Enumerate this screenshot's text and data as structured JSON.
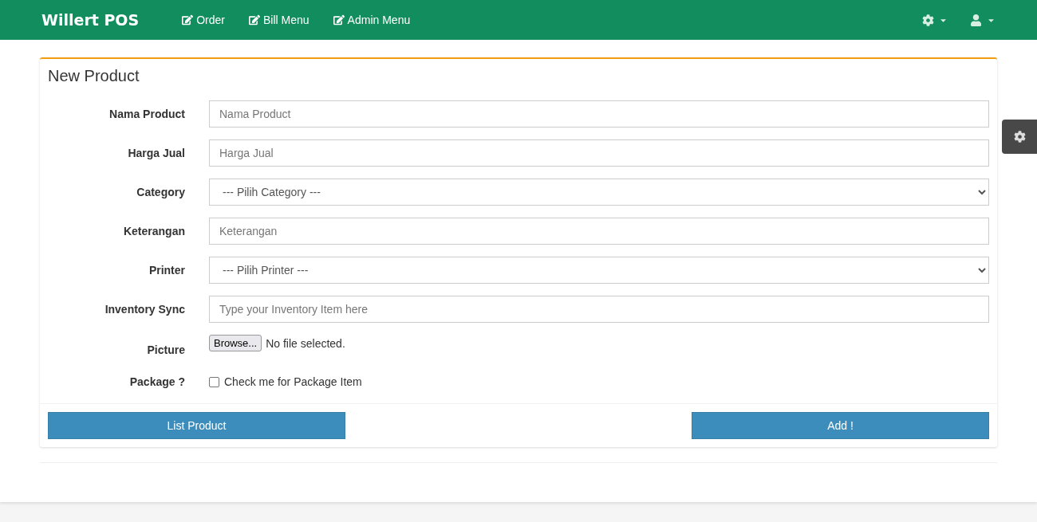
{
  "navbar": {
    "brand": "Willert POS",
    "links": [
      {
        "label": "Order"
      },
      {
        "label": "Bill Menu"
      },
      {
        "label": "Admin Menu"
      }
    ]
  },
  "panel": {
    "title": "New Product",
    "fields": [
      {
        "kind": "text",
        "label": "Nama Product",
        "placeholder": "Nama Product"
      },
      {
        "kind": "text",
        "label": "Harga Jual",
        "placeholder": "Harga Jual"
      },
      {
        "kind": "select",
        "label": "Category",
        "value": "--- Pilih Category ---"
      },
      {
        "kind": "text",
        "label": "Keterangan",
        "placeholder": "Keterangan"
      },
      {
        "kind": "select",
        "label": "Printer",
        "value": "--- Pilih Printer ---"
      },
      {
        "kind": "text",
        "label": "Inventory Sync",
        "placeholder": "Type your Inventory Item here"
      },
      {
        "kind": "file",
        "label": "Picture",
        "button": "Browse...",
        "status": "No file selected."
      },
      {
        "kind": "checkbox",
        "label": "Package ?",
        "text": "Check me for Package Item",
        "checked": false
      }
    ],
    "buttons": [
      "List Product",
      "Add !"
    ]
  }
}
